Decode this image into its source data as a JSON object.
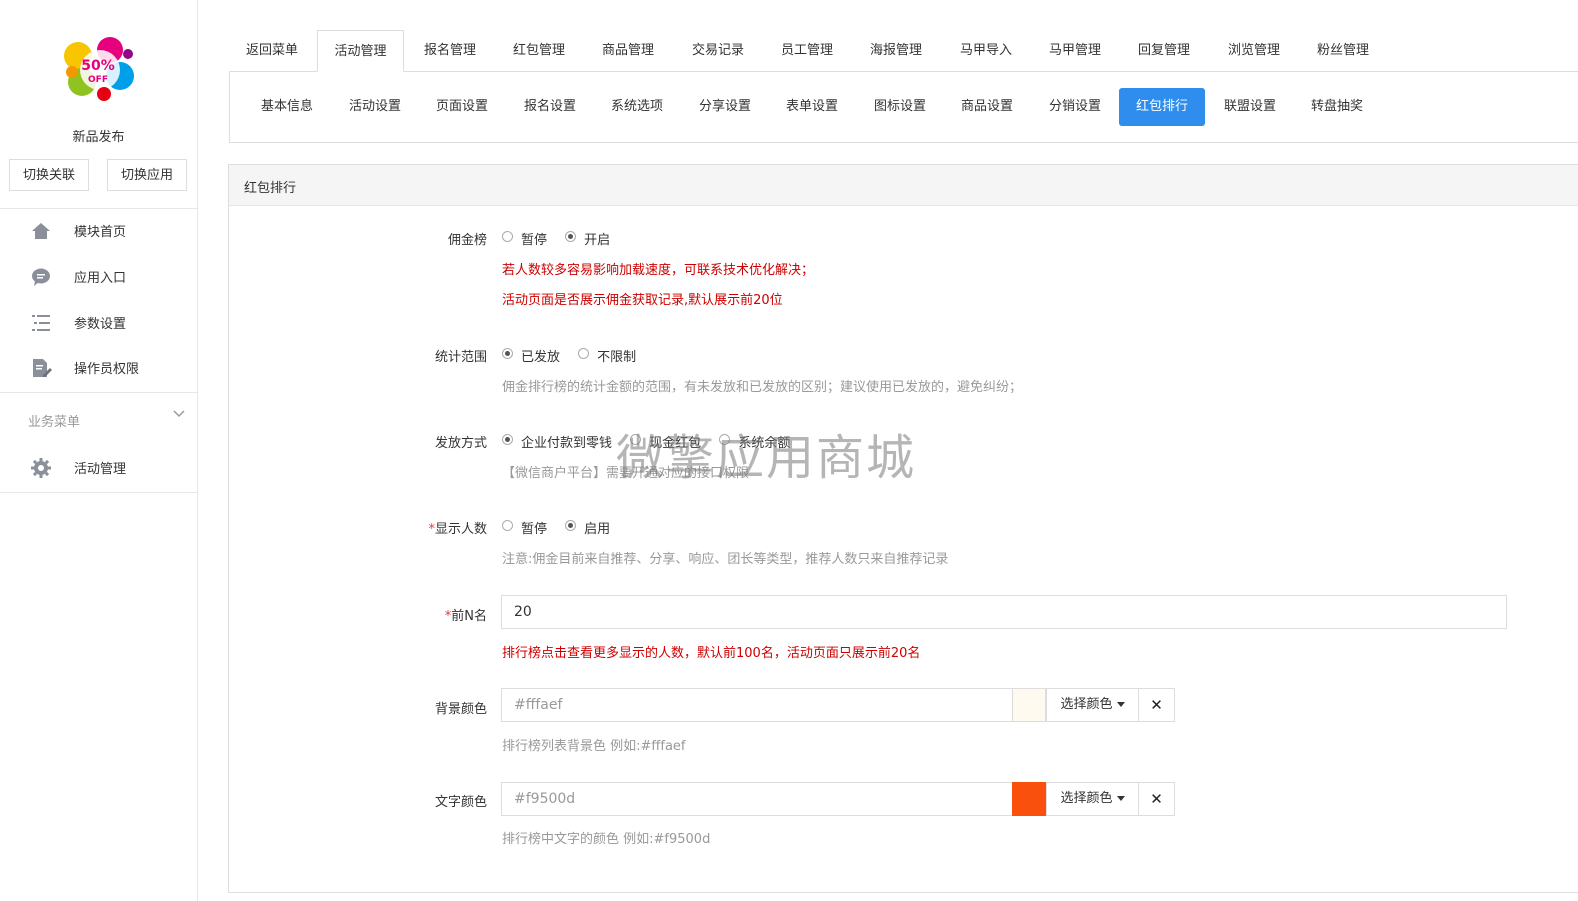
{
  "sidebar": {
    "app_name": "新品发布",
    "switch_link": "切换关联",
    "switch_app": "切换应用",
    "nav": [
      {
        "label": "模块首页",
        "icon": "home-icon"
      },
      {
        "label": "应用入口",
        "icon": "chat-icon"
      },
      {
        "label": "参数设置",
        "icon": "list-icon"
      },
      {
        "label": "操作员权限",
        "icon": "edit-doc-icon"
      }
    ],
    "business_menu": "业务菜单",
    "business_items": [
      {
        "label": "活动管理",
        "icon": "gear-icon"
      }
    ]
  },
  "top_tabs": [
    "返回菜单",
    "活动管理",
    "报名管理",
    "红包管理",
    "商品管理",
    "交易记录",
    "员工管理",
    "海报管理",
    "马甲导入",
    "马甲管理",
    "回复管理",
    "浏览管理",
    "粉丝管理"
  ],
  "top_tabs_active": "活动管理",
  "sub_tabs": [
    "基本信息",
    "活动设置",
    "页面设置",
    "报名设置",
    "系统选项",
    "分享设置",
    "表单设置",
    "图标设置",
    "商品设置",
    "分销设置",
    "红包排行",
    "联盟设置",
    "转盘抽奖"
  ],
  "sub_tabs_active": "红包排行",
  "panel_title": "红包排行",
  "form": {
    "commission": {
      "label": "佣金榜",
      "options": [
        "暂停",
        "开启"
      ],
      "selected": "开启",
      "hint1": "若人数较多容易影响加载速度，可联系技术优化解决；",
      "hint2": "活动页面是否展示佣金获取记录,默认展示前20位"
    },
    "range": {
      "label": "统计范围",
      "options": [
        "已发放",
        "不限制"
      ],
      "selected": "已发放",
      "hint": "佣金排行榜的统计金额的范围，有未发放和已发放的区别；建议使用已发放的，避免纠纷；"
    },
    "payout": {
      "label": "发放方式",
      "options": [
        "企业付款到零钱",
        "现金红包",
        "系统余额"
      ],
      "selected": "企业付款到零钱",
      "hint": "【微信商户平台】需要开通对应的接口权限"
    },
    "show_count": {
      "required": "*",
      "label": "显示人数",
      "options": [
        "暂停",
        "启用"
      ],
      "selected": "启用",
      "hint": "注意:佣金目前来自推荐、分享、响应、团长等类型，推荐人数只来自推荐记录"
    },
    "top_n": {
      "required": "*",
      "label": "前N名",
      "value": "20",
      "hint": "排行榜点击查看更多显示的人数，默认前100名，活动页面只展示前20名"
    },
    "bg_color": {
      "label": "背景颜色",
      "placeholder": "#fffaef",
      "swatch": "#fffaef",
      "pick": "选择颜色",
      "hint": "排行榜列表背景色 例如:#fffaef"
    },
    "text_color": {
      "label": "文字颜色",
      "placeholder": "#f9500d",
      "swatch": "#f9500d",
      "pick": "选择颜色",
      "hint": "排行榜中文字的颜色 例如:#f9500d"
    }
  },
  "watermark": "微擎应用商城",
  "colors": {
    "accent": "#2e8ded",
    "warning": "#cc0000"
  }
}
